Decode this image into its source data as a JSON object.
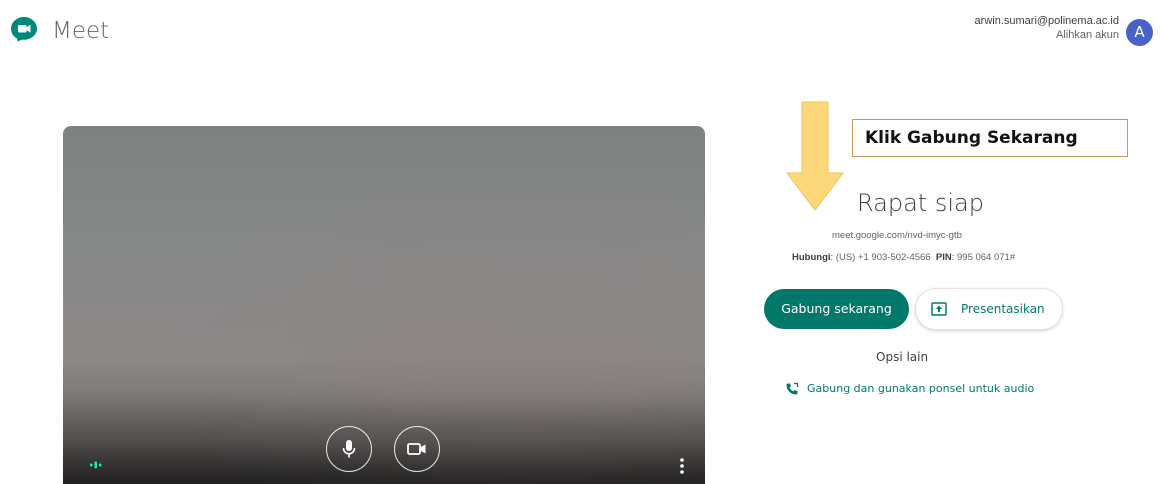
{
  "header": {
    "app_name": "Meet",
    "account_email": "arwin.sumari@polinema.ac.id",
    "switch_account": "Alihkan akun",
    "avatar_letter": "A",
    "avatar_color": "#4863c7"
  },
  "annotation": {
    "callout": "Klik Gabung Sekarang",
    "arrow_color": "#fcd87a"
  },
  "join_panel": {
    "title": "Rapat siap",
    "meeting_url": "meet.google.com/nvd-imyc-gtb",
    "dial_label": "Hubungi",
    "dial_value": "(US) +1 903-502-4566",
    "pin_label": "PIN",
    "pin_value": "995 064 071#",
    "join_button": "Gabung sekarang",
    "present_button": "Presentasikan",
    "more_options": "Opsi lain",
    "phone_audio_link": "Gabung dan gunakan ponsel untuk audio",
    "accent_color": "#00796b"
  },
  "preview": {
    "icons": [
      "microphone-icon",
      "camera-icon",
      "more-vert-icon",
      "audio-level-icon"
    ]
  }
}
